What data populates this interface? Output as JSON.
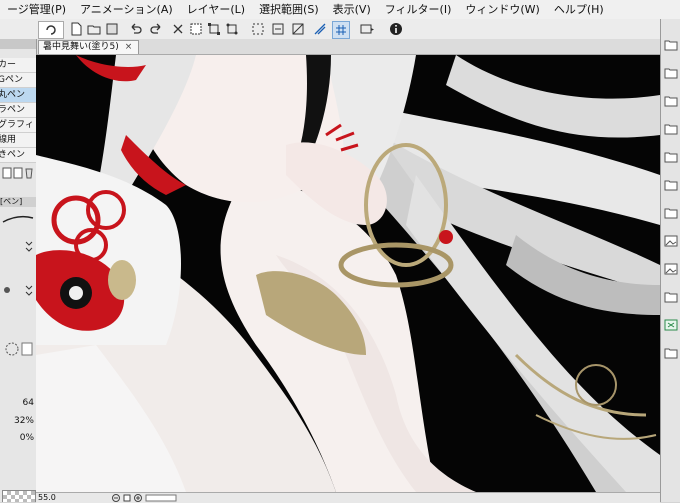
{
  "menu": [
    "ージ管理(P)",
    "アニメーション(A)",
    "レイヤー(L)",
    "選択範囲(S)",
    "表示(V)",
    "フィルター(I)",
    "ウィンドウ(W)",
    "ヘルプ(H)"
  ],
  "document_tab": {
    "title": "暑中見舞い(塗り5)",
    "close": "×"
  },
  "brushes": [
    "カー",
    "Gペン",
    "丸ペン",
    "ラペン",
    "グラフィ",
    "線用",
    "きペン"
  ],
  "sub_tool_group": "[ペン]",
  "properties": {
    "value1": "64",
    "value2": "32%",
    "value3": "0%"
  },
  "status": {
    "zoom": "55.0"
  },
  "colors": {
    "menubar": "#f0f0f0",
    "canvas_bg": "#050505",
    "accent_red": "#c8141c",
    "selected": "#bcd8f0"
  }
}
